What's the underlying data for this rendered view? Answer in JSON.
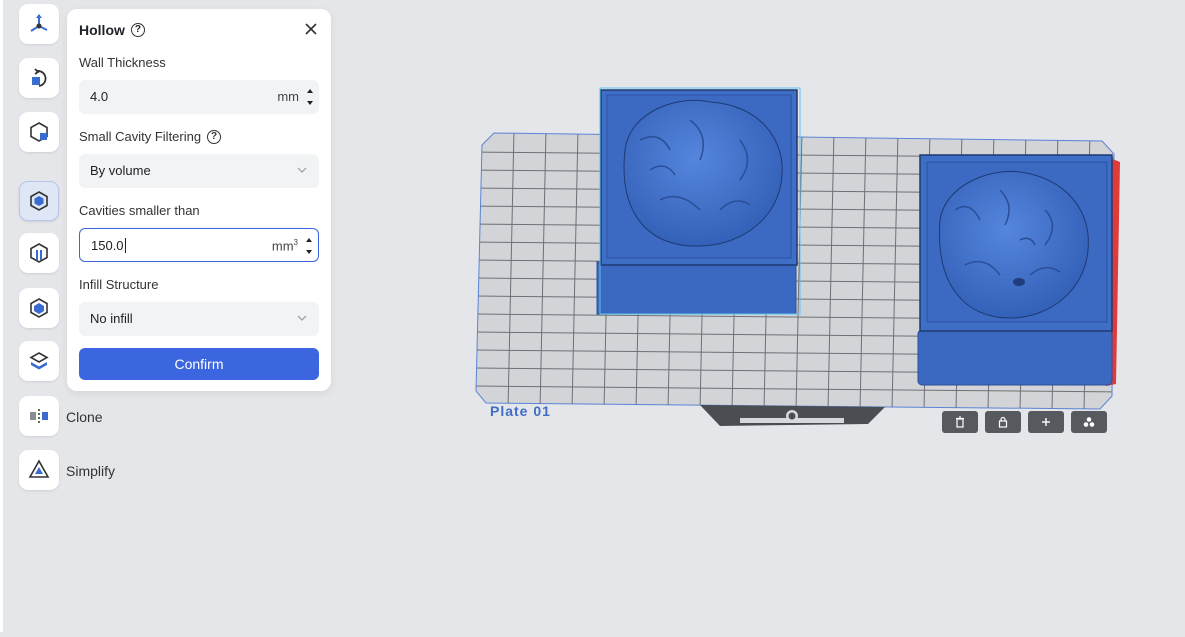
{
  "panel": {
    "title": "Hollow",
    "wall_thickness": {
      "label": "Wall Thickness",
      "value": "4.0",
      "unit": "mm"
    },
    "cavity_filtering": {
      "label": "Small Cavity Filtering",
      "selected": "By volume"
    },
    "cavities_smaller": {
      "label": "Cavities smaller than",
      "value": "150.0",
      "unit": "mm"
    },
    "infill": {
      "label": "Infill Structure",
      "selected": "No infill"
    },
    "confirm_label": "Confirm"
  },
  "tools": [
    {
      "name": "move-tool",
      "icon": "move-icon"
    },
    {
      "name": "rotate-tool",
      "icon": "rotate-icon"
    },
    {
      "name": "scale-tool",
      "icon": "scale-icon"
    },
    {
      "name": "hollow-tool",
      "icon": "hollow-cube-icon",
      "active": true
    },
    {
      "name": "punch-tool",
      "icon": "punch-icon"
    },
    {
      "name": "solid-tool",
      "icon": "solid-cube-icon"
    },
    {
      "name": "cut-tool",
      "icon": "cut-icon"
    }
  ],
  "clone_label": "Clone",
  "simplify_label": "Simplify",
  "plate": {
    "label": "Plate 01"
  },
  "plate_actions": [
    "delete-icon",
    "lock-icon",
    "add-icon",
    "arrange-icon"
  ],
  "colors": {
    "accent": "#3b66e0",
    "model": "#3f6ec6",
    "plate": "#d2d4d8",
    "error_edge": "#e03a3a"
  }
}
